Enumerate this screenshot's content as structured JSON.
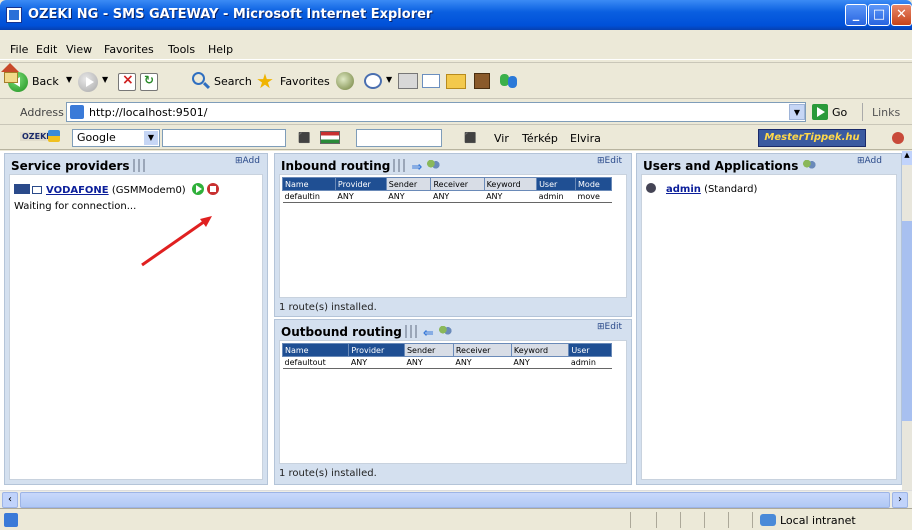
{
  "window": {
    "title": "OZEKI NG - SMS GATEWAY - Microsoft Internet Explorer"
  },
  "menu": [
    "File",
    "Edit",
    "View",
    "Favorites",
    "Tools",
    "Help"
  ],
  "toolbar": {
    "back_label": "Back",
    "search_label": "Search",
    "favorites_label": "Favorites"
  },
  "address": {
    "label": "Address",
    "url": "http://localhost:9501/",
    "go_label": "Go",
    "links_label": "Links"
  },
  "googlebar": {
    "ozeki_label": "OZEKI",
    "search_engine": "Google",
    "vir_label": "Vir",
    "terkep_label": "Térkép",
    "elvira_label": "Elvira",
    "mestertippek_label": "MesterTippek.hu"
  },
  "service_providers": {
    "title": "Service providers",
    "add_label": "Add",
    "provider_name": "VODAFONE",
    "provider_type": "(GSMModem0)",
    "status": "Waiting for connection..."
  },
  "inbound": {
    "title": "Inbound routing",
    "edit_label": "Edit",
    "columns": [
      "Name",
      "Provider",
      "Sender",
      "Receiver",
      "Keyword",
      "User",
      "Mode"
    ],
    "rows": [
      [
        "defaultin",
        "ANY",
        "ANY",
        "ANY",
        "ANY",
        "admin",
        "move"
      ]
    ],
    "footer": "1 route(s) installed."
  },
  "outbound": {
    "title": "Outbound routing",
    "edit_label": "Edit",
    "columns": [
      "Name",
      "Provider",
      "Sender",
      "Receiver",
      "Keyword",
      "User"
    ],
    "rows": [
      [
        "defaultout",
        "ANY",
        "ANY",
        "ANY",
        "ANY",
        "admin"
      ]
    ],
    "footer": "1 route(s) installed."
  },
  "users": {
    "title": "Users and Applications",
    "add_label": "Add",
    "user_name": "admin",
    "user_type": "(Standard)"
  },
  "statusbar": {
    "zone": "Local intranet"
  }
}
